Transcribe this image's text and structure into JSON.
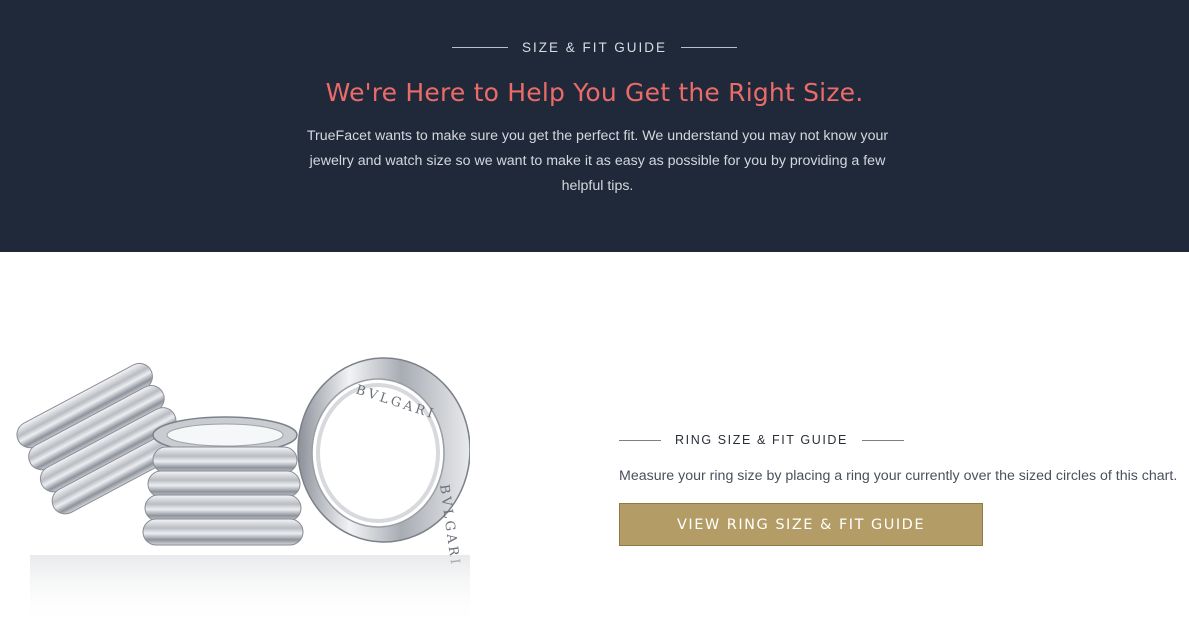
{
  "hero": {
    "eyebrow": "SIZE & FIT GUIDE",
    "headline": "We're Here to Help You Get the Right Size.",
    "intro": "TrueFacet wants to make sure you get the perfect fit. We understand you may not know your jewelry and watch size so we want to make it as easy as possible for you by providing a few helpful tips."
  },
  "photo": {
    "engraving_left": "BVLGARI",
    "engraving_right": "BVLGARI"
  },
  "ring_guide": {
    "eyebrow": "RING SIZE & FIT GUIDE",
    "text": "Measure your ring size by placing a ring your currently over the sized circles of this chart.",
    "button_label": "VIEW RING SIZE & FIT GUIDE"
  },
  "colors": {
    "hero_bg": "#20293a",
    "headline": "#eb6b69",
    "button_bg": "#b39c65"
  }
}
